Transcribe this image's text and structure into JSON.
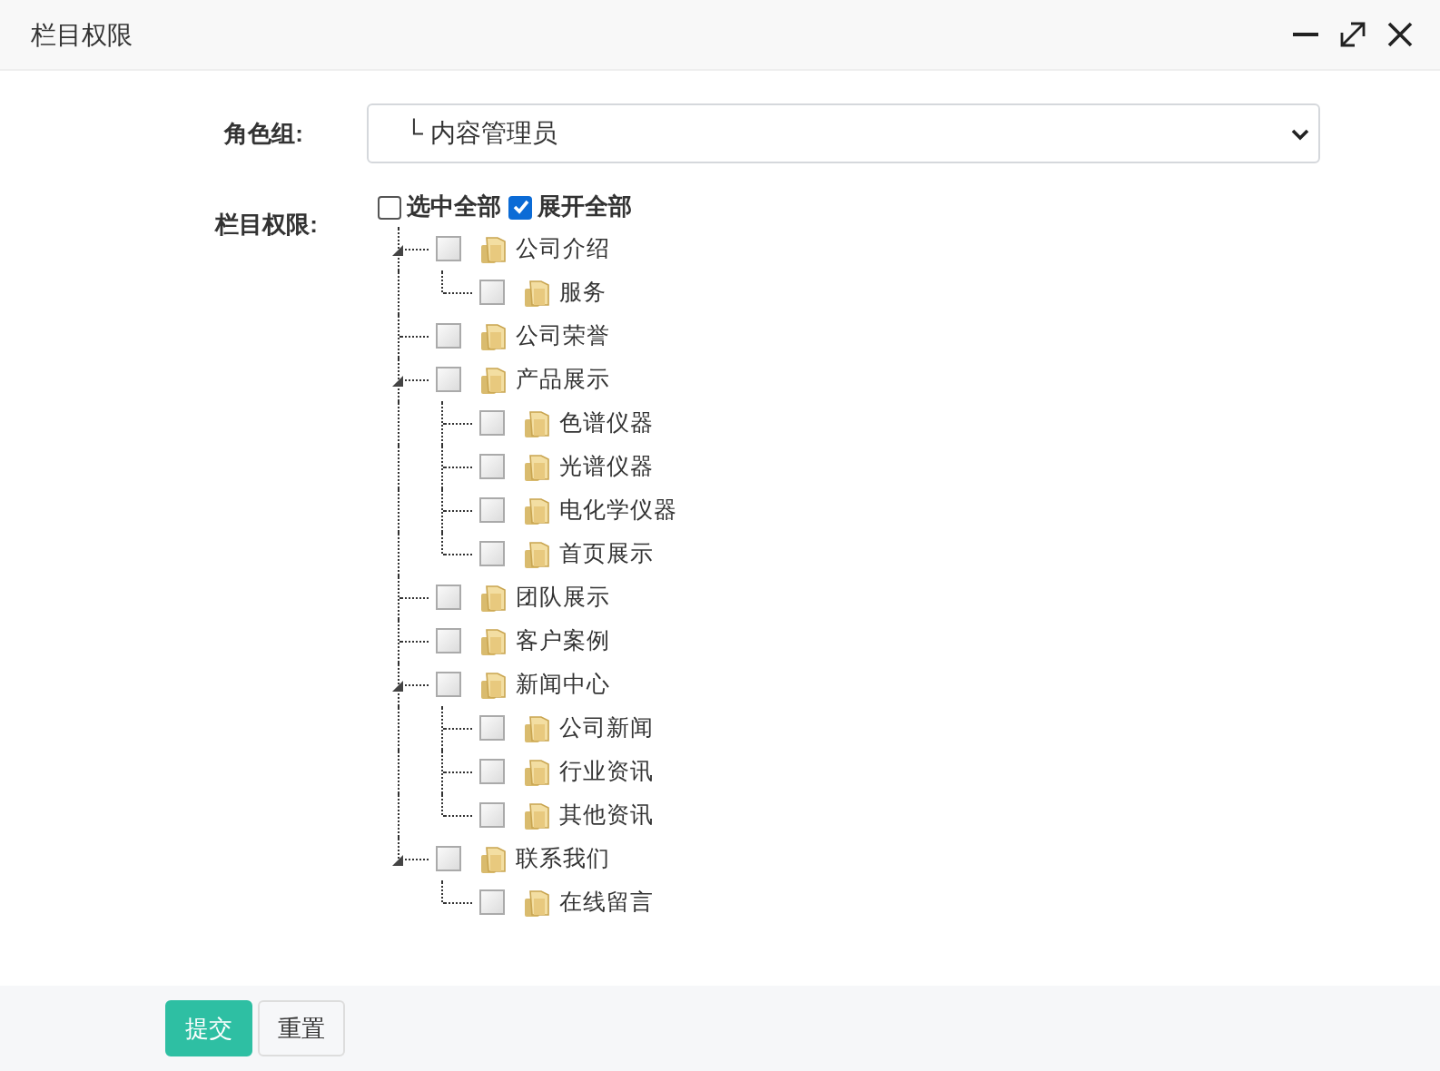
{
  "window": {
    "title": "栏目权限"
  },
  "form": {
    "role_group": {
      "label": "角色组:",
      "value": "└ 内容管理员"
    },
    "permissions": {
      "label": "栏目权限:",
      "select_all": {
        "label": "选中全部",
        "checked": false
      },
      "expand_all": {
        "label": "展开全部",
        "checked": true
      },
      "tree": [
        {
          "label": "公司介绍",
          "checked": false,
          "expanded": true,
          "children": [
            {
              "label": "服务",
              "checked": false
            }
          ]
        },
        {
          "label": "公司荣誉",
          "checked": false
        },
        {
          "label": "产品展示",
          "checked": false,
          "expanded": true,
          "children": [
            {
              "label": "色谱仪器",
              "checked": false
            },
            {
              "label": "光谱仪器",
              "checked": false
            },
            {
              "label": "电化学仪器",
              "checked": false
            },
            {
              "label": "首页展示",
              "checked": false
            }
          ]
        },
        {
          "label": "团队展示",
          "checked": false
        },
        {
          "label": "客户案例",
          "checked": false
        },
        {
          "label": "新闻中心",
          "checked": false,
          "expanded": true,
          "children": [
            {
              "label": "公司新闻",
              "checked": false
            },
            {
              "label": "行业资讯",
              "checked": false
            },
            {
              "label": "其他资讯",
              "checked": false
            }
          ]
        },
        {
          "label": "联系我们",
          "checked": false,
          "expanded": true,
          "children": [
            {
              "label": "在线留言",
              "checked": false
            }
          ]
        }
      ]
    }
  },
  "buttons": [
    {
      "label": "提交",
      "kind": "primary"
    },
    {
      "label": "重置",
      "kind": "default"
    }
  ]
}
